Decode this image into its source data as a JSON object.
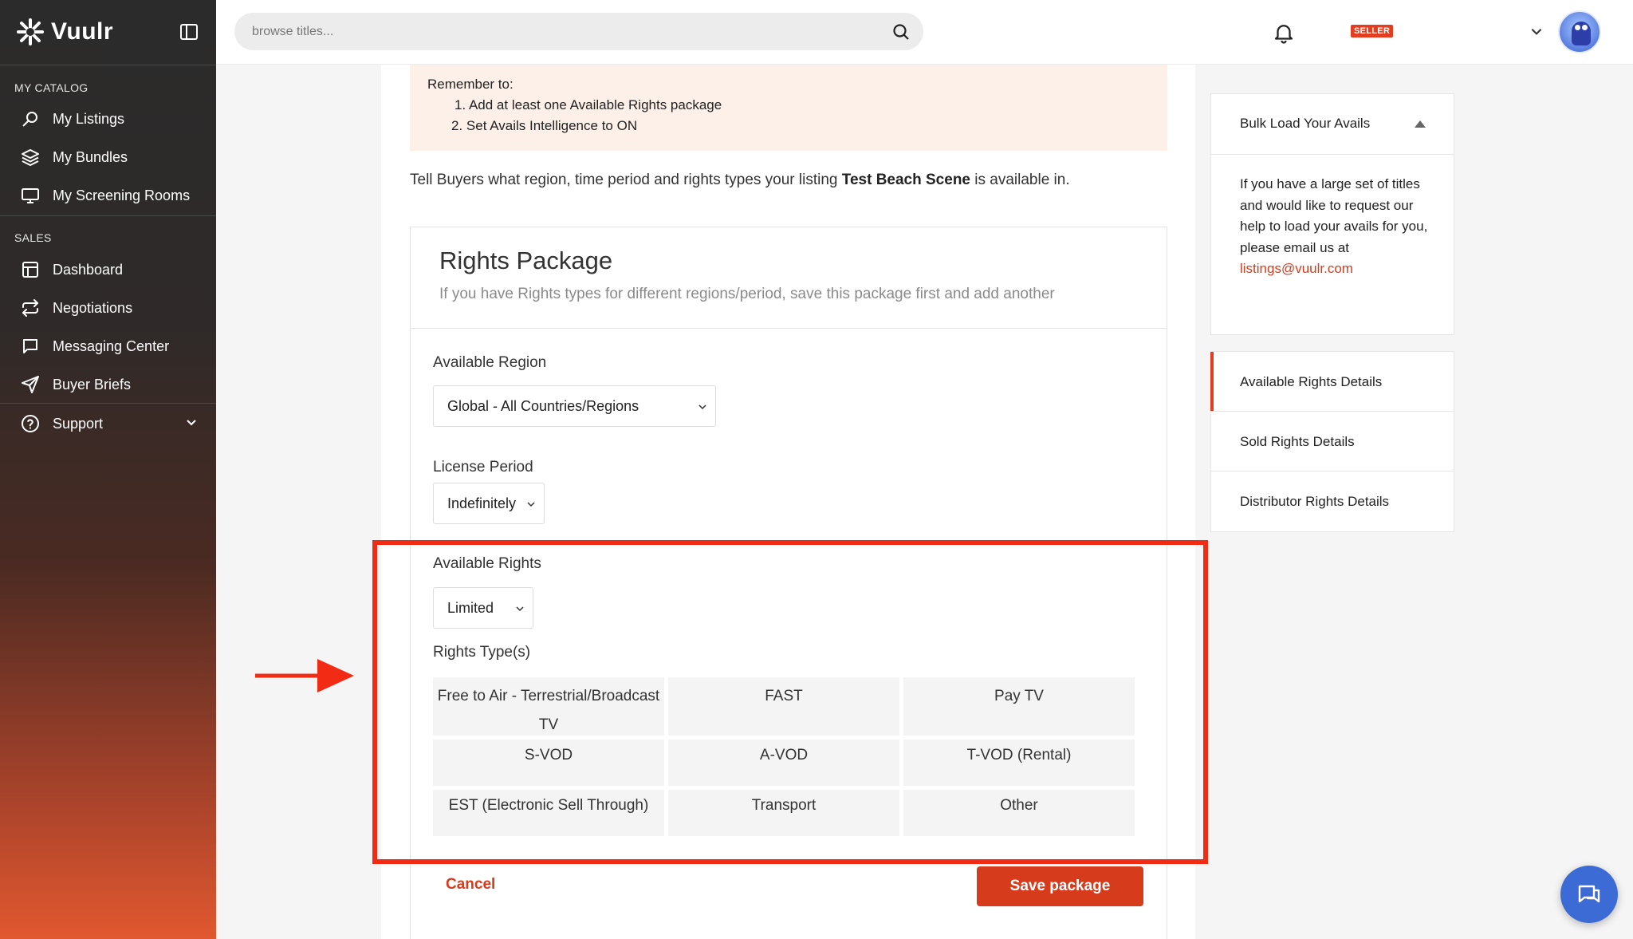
{
  "app": {
    "brand": "Vuulr"
  },
  "search": {
    "placeholder": "browse titles..."
  },
  "topbar": {
    "seller_badge": "SELLER"
  },
  "sidebar": {
    "sections": [
      {
        "label": "MY CATALOG"
      },
      {
        "label": "SALES"
      }
    ],
    "items": [
      {
        "label": "My Listings",
        "icon": "search-icon"
      },
      {
        "label": "My Bundles",
        "icon": "layers-icon"
      },
      {
        "label": "My Screening Rooms",
        "icon": "monitor-icon"
      },
      {
        "label": "Dashboard",
        "icon": "dashboard-icon"
      },
      {
        "label": "Negotiations",
        "icon": "swap-icon"
      },
      {
        "label": "Messaging Center",
        "icon": "message-icon"
      },
      {
        "label": "Buyer Briefs",
        "icon": "send-icon"
      },
      {
        "label": "Support",
        "icon": "help-icon"
      }
    ]
  },
  "notice": {
    "remember": "Remember to:",
    "items": [
      "1. Add at least one Available Rights package",
      "2. Set Avails Intelligence to ON"
    ]
  },
  "intro": {
    "before": "Tell Buyers what region, time period and rights types your listing ",
    "title": "Test Beach Scene",
    "after": " is available in."
  },
  "package": {
    "title": "Rights Package",
    "subtitle": "If you have Rights types for different regions/period, save this package first and add another",
    "region_label": "Available Region",
    "region_value": "Global - All Countries/Regions",
    "period_label": "License Period",
    "period_value": "Indefinitely",
    "rights_label": "Available Rights",
    "rights_value": "Limited",
    "types_label": "Rights Type(s)",
    "types": [
      "Free to Air - Terrestrial/Broadcast TV",
      "FAST",
      "Pay TV",
      "S-VOD",
      "A-VOD",
      "T-VOD (Rental)",
      "EST (Electronic Sell Through)",
      "Transport",
      "Other"
    ],
    "cancel": "Cancel",
    "save": "Save package"
  },
  "bulk": {
    "title": "Bulk Load Your Avails",
    "body": "If you have a large set of titles and would like to request our help to load your avails for you, please email us at",
    "email": "listings@vuulr.com"
  },
  "details_nav": [
    "Available Rights Details",
    "Sold Rights Details",
    "Distributor Rights Details"
  ],
  "colors": {
    "accent": "#d63b1c",
    "highlight": "#f22b14",
    "chat": "#3d6bd6"
  }
}
